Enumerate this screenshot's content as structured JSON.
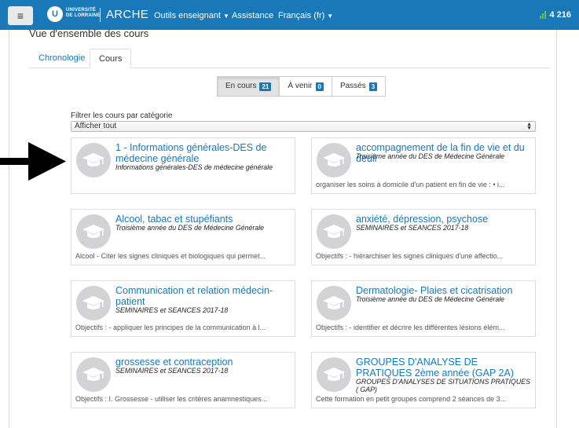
{
  "navbar": {
    "menu_icon": "hamburger-menu-icon",
    "logo_letter": "U",
    "logo_line1": "UNIVERSITÉ",
    "logo_line2": "DE LORRAINE",
    "app_name": "ARCHE",
    "menus": [
      {
        "label": "Outils enseignant",
        "has_caret": true
      },
      {
        "label": "Assistance",
        "has_caret": false
      },
      {
        "label": "Français (fr)",
        "has_caret": true
      }
    ],
    "stats_icon": "bar-chart-icon",
    "stats_value": "4 216"
  },
  "block_title": "Vue d'ensemble des cours",
  "tabs": [
    {
      "label": "Chronologie",
      "active": false
    },
    {
      "label": "Cours",
      "active": true
    }
  ],
  "filters": [
    {
      "label": "En cours",
      "count": "21",
      "active": true
    },
    {
      "label": "À venir",
      "count": "0",
      "active": false
    },
    {
      "label": "Passés",
      "count": "3",
      "active": false
    }
  ],
  "category_filter": {
    "label": "Filtrer les cours par catégorie",
    "selected": "Afficher tout"
  },
  "courses": [
    {
      "title": "1 - Informations générales-DES de médecine générale",
      "category": "Informations générales-DES de médecine générale",
      "summary": ""
    },
    {
      "title": "accompagnement de la fin de vie et du deuil",
      "category": "Troisième année du DES de Médecine Générale",
      "summary": "organiser les soins à domicile d'un patient en fin de vie : • i..."
    },
    {
      "title": "Alcool, tabac et stupéfiants",
      "category": "Troisième année du DES de Médecine Générale",
      "summary": "Alcool - Citer les signes cliniques et biologiques qui permet..."
    },
    {
      "title": "anxiété, dépression, psychose",
      "category": "SEMINAIRES et SEANCES 2017-18",
      "summary": "Objectifs : - hiérarchiser les signes cliniques d'une affectio..."
    },
    {
      "title": "Communication et relation médecin-patient",
      "category": "SEMINAIRES et SEANCES 2017-18",
      "summary": "Objectifs : - appliquer les principes de la communication à l..."
    },
    {
      "title": "Dermatologie- Plaies et cicatrisation",
      "category": "Troisième année du DES de Médecine Générale",
      "summary": "Objectifs : - identifier et décrire les différentes lésions élém..."
    },
    {
      "title": "grossesse et contraception",
      "category": "SEMINAIRES et SEANCES 2017-18",
      "summary": "Objectifs : I. Grossesse - utiliser les critères anamnestiques..."
    },
    {
      "title": "GROUPES D'ANALYSE DE PRATIQUES 2ème année (GAP 2A)",
      "category": "GROUPES D'ANALYSES DE SITUATIONS PRATIQUES ( GAP)",
      "summary": "Cette formation en petit groupes comprend 2 séances de 3..."
    }
  ],
  "course_icon": "graduation-cap-icon",
  "annotation_icon": "arrow-right-icon",
  "colors": {
    "brand": "#1878b8",
    "badge": "#1878b8",
    "stats_green": "#6fbf3a"
  }
}
